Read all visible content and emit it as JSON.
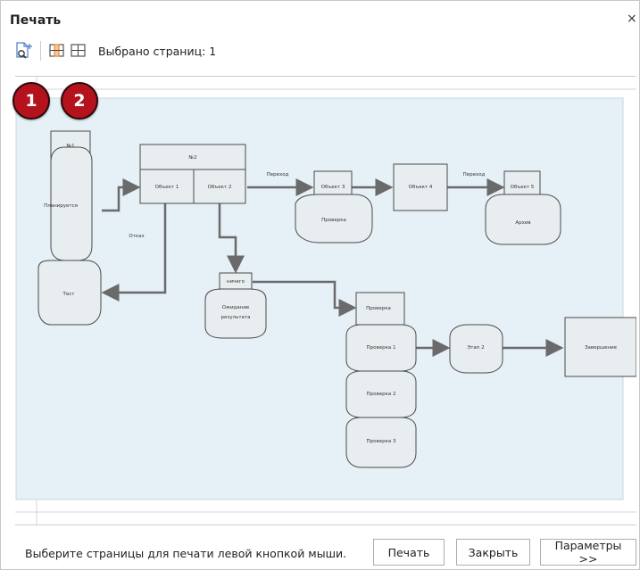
{
  "window": {
    "title": "Печать",
    "close_glyph": "×"
  },
  "toolbar": {
    "selected_pages": "Выбрано страниц: 1"
  },
  "badges": {
    "first": "1",
    "second": "2"
  },
  "footer": {
    "hint": "Выберите страницы для печати левой кнопкой мыши.",
    "print_label": "Печать",
    "close_label": "Закрыть",
    "params_label": "Параметры >>"
  },
  "diagram": {
    "n1": "№1",
    "n2": "№2",
    "obj1": "Объект 1",
    "obj2": "Объект 2",
    "obj3": "Объект 3",
    "obj4": "Объект 4",
    "obj5": "Объект 5",
    "planned": "Планируется",
    "test": "Тест",
    "refusal": "Отказ",
    "transition1": "Переход",
    "transition2": "Переход",
    "check_oval": "Проверка",
    "archive": "Архив",
    "nothing": "ничего",
    "waiting1": "Ожидание",
    "waiting2": "результата",
    "check_box": "Проверка",
    "check1": "Проверка 1",
    "check2": "Проверка 2",
    "check3": "Проверка 3",
    "stage2": "Этап 2",
    "completion": "Завершение"
  },
  "colors": {
    "badge": "#b4131e",
    "page_bg": "#e5f0f7",
    "shape_fill": "#e8eef0",
    "connector": "#6a6a6a"
  }
}
